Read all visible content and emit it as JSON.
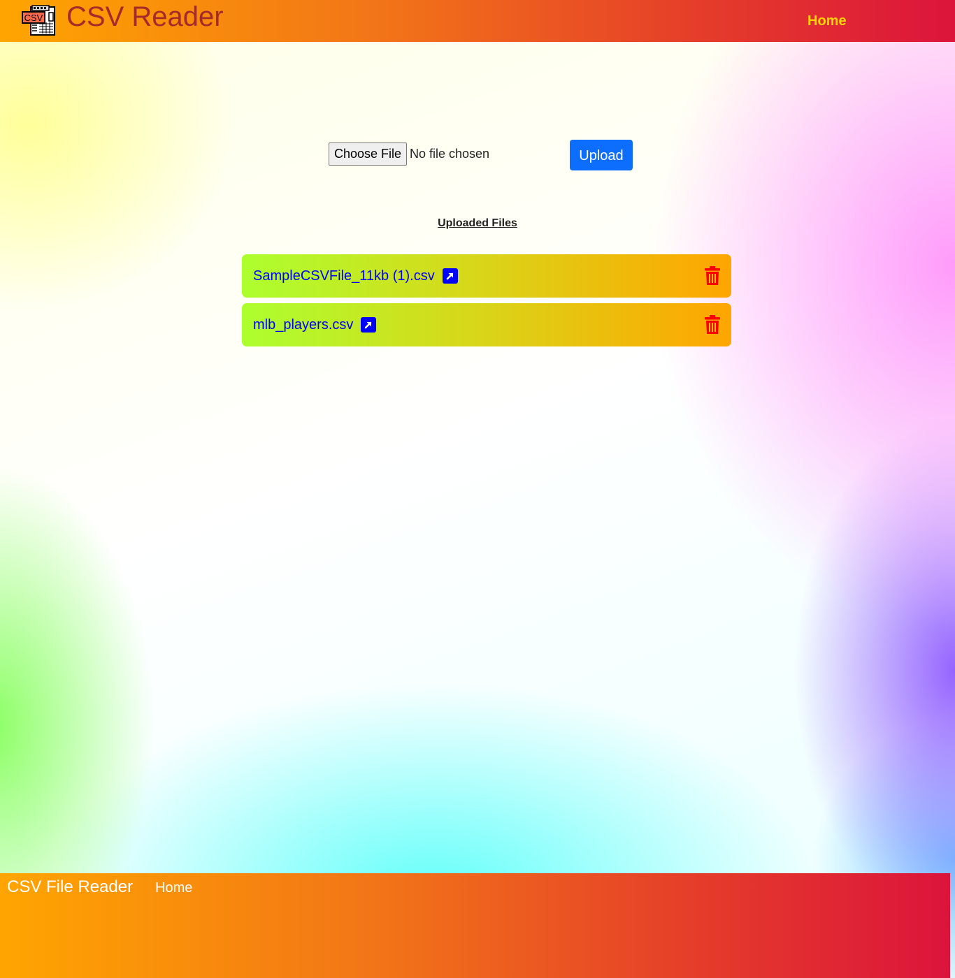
{
  "header": {
    "logo_label": "CSV",
    "brand": "CSV Reader",
    "nav": [
      {
        "label": "Home"
      }
    ]
  },
  "upload": {
    "choose_file_label": "Choose File",
    "file_status": "No file chosen",
    "upload_label": "Upload"
  },
  "files": {
    "heading": "Uploaded Files",
    "items": [
      {
        "name": "SampleCSVFile_11kb (1).csv",
        "open_icon": "external-link-icon",
        "delete_icon": "trash-icon"
      },
      {
        "name": "mlb_players.csv",
        "open_icon": "external-link-icon",
        "delete_icon": "trash-icon"
      }
    ]
  },
  "footer": {
    "brand": "CSV File Reader",
    "nav": [
      {
        "label": "Home"
      }
    ]
  },
  "colors": {
    "header_gradient_start": "#ffa500",
    "header_gradient_end": "#dc143c",
    "brand_text": "#a52a2a",
    "nav_text": "#ffd700",
    "upload_button": "#0d6efd",
    "file_row_gradient_start": "#adff2f",
    "file_row_gradient_end": "#ffa500",
    "file_link": "#0000ff",
    "delete_icon": "#ff0000"
  }
}
